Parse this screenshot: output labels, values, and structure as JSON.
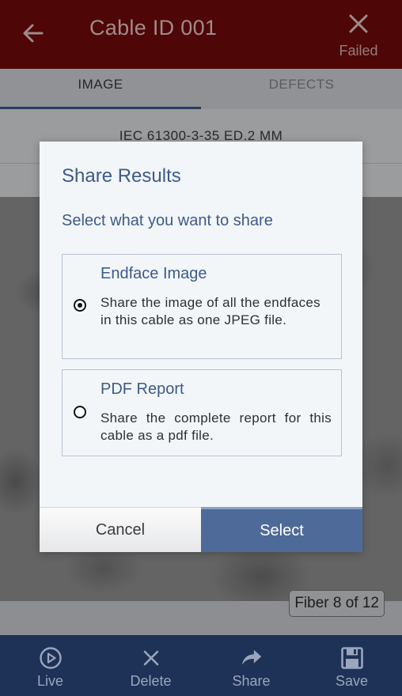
{
  "header": {
    "back_icon": "arrow-left-icon",
    "title": "Cable ID 001",
    "close_icon": "close-icon",
    "status_label": "Failed",
    "color": "#7a0a0a"
  },
  "tabs": [
    {
      "label": "IMAGE",
      "active": true
    },
    {
      "label": "DEFECTS",
      "active": false
    }
  ],
  "standard": "IEC 61300-3-35 ED.2 MM",
  "fiber_badge": "Fiber 8 of 12",
  "toolbar": {
    "items": [
      {
        "label": "Live",
        "icon": "play-circle-icon"
      },
      {
        "label": "Delete",
        "icon": "close-icon"
      },
      {
        "label": "Share",
        "icon": "share-arrow-icon"
      },
      {
        "label": "Save",
        "icon": "save-disk-icon"
      }
    ],
    "color": "#1e3157"
  },
  "dialog": {
    "title": "Share Results",
    "subtitle": "Select what you want to share",
    "options": [
      {
        "title": "Endface Image",
        "description": "Share the image of all the endfaces in this cable as one JPEG file.",
        "selected": true
      },
      {
        "title": "PDF Report",
        "description": "Share the complete report for this cable as a pdf file.",
        "selected": false
      }
    ],
    "cancel_label": "Cancel",
    "select_label": "Select",
    "accent": "#3e5a88"
  }
}
